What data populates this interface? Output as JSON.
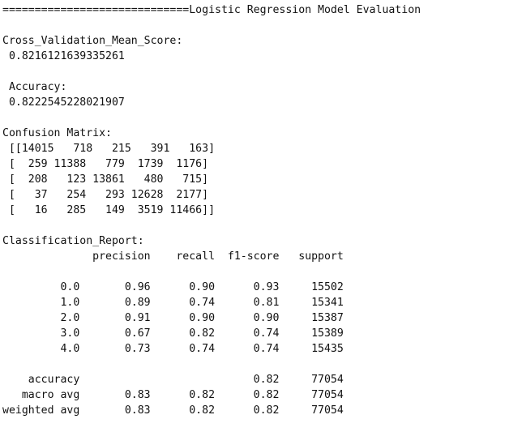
{
  "console_lines": [
    "=============================Logistic Regression Model Evaluation",
    "",
    "Cross_Validation_Mean_Score:",
    " 0.8216121639335261",
    "",
    " Accuracy:",
    " 0.8222545228021907",
    "",
    "Confusion Matrix:",
    " [[14015   718   215   391   163]",
    " [  259 11388   779  1739  1176]",
    " [  208   123 13861   480   715]",
    " [   37   254   293 12628  2177]",
    " [   16   285   149  3519 11466]]",
    "",
    "Classification_Report:",
    "              precision    recall  f1-score   support",
    "",
    "         0.0       0.96      0.90      0.93     15502",
    "         1.0       0.89      0.74      0.81     15341",
    "         2.0       0.91      0.90      0.90     15387",
    "         3.0       0.67      0.82      0.74     15389",
    "         4.0       0.73      0.74      0.74     15435",
    "",
    "    accuracy                           0.82     77054",
    "   macro avg       0.83      0.82      0.82     77054",
    "weighted avg       0.83      0.82      0.82     77054"
  ]
}
